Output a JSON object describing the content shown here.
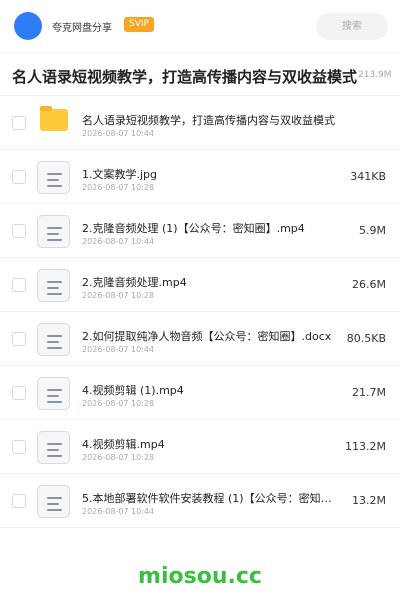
{
  "header": {
    "app_name": "夸克网盘分享",
    "badge": "SVIP",
    "search_placeholder": "搜索",
    "brand_color": "#2f7df6",
    "badge_color": "#f6a623"
  },
  "folder": {
    "title": "名人语录短视频教学，打造高传播内容与双收益模式",
    "size": "213.9M"
  },
  "files": [
    {
      "type": "folder",
      "icon": "folder-icon",
      "name": "名人语录短视频教学，打造高传播内容与双收益模式",
      "date": "2026-08-07 10:44",
      "size": ""
    },
    {
      "type": "file",
      "icon": "document-icon",
      "name": "1.文案教学.jpg",
      "date": "2026-08-07 10:28",
      "size": "341KB"
    },
    {
      "type": "file",
      "icon": "document-icon",
      "name": "2.克隆音频处理 (1)【公众号：密知圈】.mp4",
      "date": "2026-08-07 10:44",
      "size": "5.9M"
    },
    {
      "type": "file",
      "icon": "document-icon",
      "name": "2.克隆音频处理.mp4",
      "date": "2026-08-07 10:28",
      "size": "26.6M"
    },
    {
      "type": "file",
      "icon": "document-icon",
      "name": "2.如何提取纯净人物音频【公众号：密知圈】.docx",
      "date": "2026-08-07 10:44",
      "size": "80.5KB"
    },
    {
      "type": "file",
      "icon": "document-icon",
      "name": "4.视频剪辑 (1).mp4",
      "date": "2026-08-07 10:28",
      "size": "21.7M"
    },
    {
      "type": "file",
      "icon": "document-icon",
      "name": "4.视频剪辑.mp4",
      "date": "2026-08-07 10:28",
      "size": "113.2M"
    },
    {
      "type": "file",
      "icon": "document-icon",
      "name": "5.本地部署软件软件安装教程 (1)【公众号：密知…",
      "date": "2026-08-07 10:44",
      "size": "13.2M"
    }
  ],
  "watermark": "miosou.cc",
  "watermark_color": "#3bbf3f"
}
